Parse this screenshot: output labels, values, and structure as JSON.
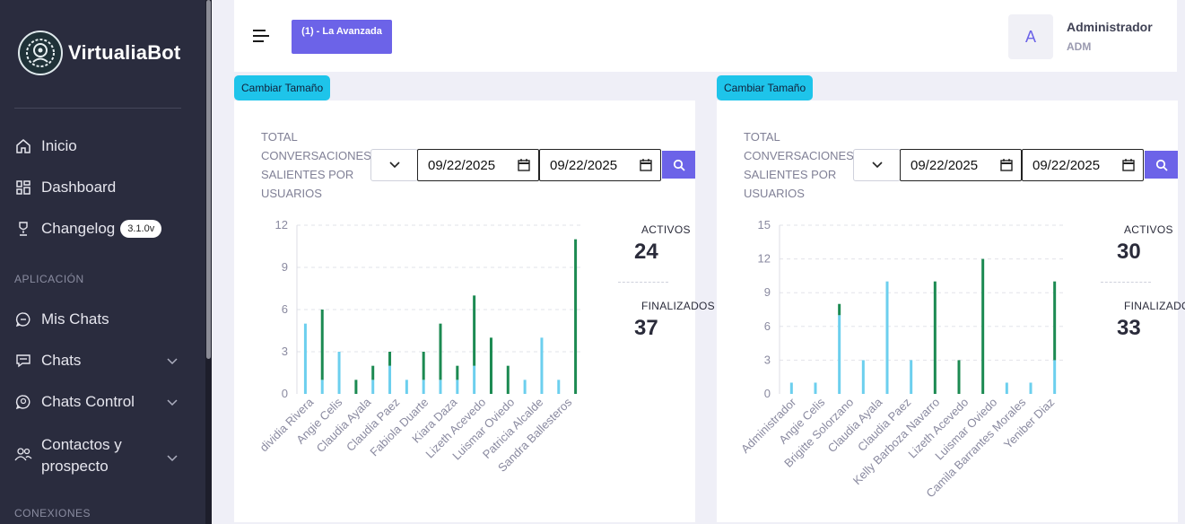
{
  "brand": {
    "name": "VirtualiaBot"
  },
  "sidebar": {
    "items": [
      {
        "label": "Inicio",
        "icon": "home-icon"
      },
      {
        "label": "Dashboard",
        "icon": "grid-icon"
      },
      {
        "label": "Changelog",
        "icon": "trophy-icon",
        "badge": "3.1.0v"
      },
      {
        "label": "Mis Chats",
        "icon": "chat-icon"
      },
      {
        "label": "Chats",
        "icon": "chat-square-icon"
      },
      {
        "label": "Chats Control",
        "icon": "chat-search-icon"
      },
      {
        "label": "Contactos y prospecto",
        "icon": "users-icon"
      }
    ],
    "sections": [
      "APLICACIÓN",
      "CONEXIONES"
    ]
  },
  "header": {
    "company_button": "(1) - La Avanzada",
    "avatar_letter": "A",
    "user_name": "Administrador",
    "user_role": "ADM"
  },
  "colors": {
    "accent": "#6c63e8",
    "cyan": "#1ec4ea",
    "bar_light": "#6ccfee",
    "bar_dark": "#1c8a52",
    "sidebar": "#2a2c3e"
  },
  "cards": [
    {
      "resize_label": "Cambiar Tamaño",
      "title": "TOTAL CONVERSACIONES SALIENTES POR USUARIOS",
      "date_from": "09/22/2025",
      "date_to": "09/22/2025",
      "activos_label": "ACTIVOS",
      "activos": "24",
      "finalizados_label": "FINALIZADOS",
      "finalizados": "37"
    },
    {
      "resize_label": "Cambiar Tamaño",
      "title": "TOTAL CONVERSACIONES SALIENTES POR USUARIOS",
      "date_from": "09/22/2025",
      "date_to": "09/22/2025",
      "activos_label": "ACTIVOS",
      "activos": "30",
      "finalizados_label": "FINALIZADOS",
      "finalizados": "33"
    }
  ],
  "chart_data": [
    {
      "type": "bar",
      "stacked": true,
      "ylim": [
        0,
        12
      ],
      "yticks": [
        0,
        3,
        6,
        9,
        12
      ],
      "xlabels": [
        "dividia Rivera",
        "Angie Celis",
        "Claudia Ayala",
        "Claudia Paez",
        "Fabiola Duarte",
        "Kiara Daza",
        "Lizeth Acevedo",
        "Luismar Oviedo",
        "Patricia Alcalde",
        "Sandra Ballesteros"
      ],
      "series": [
        {
          "color": "#6ccfee",
          "values": [
            5,
            1,
            3,
            0,
            1,
            2,
            1,
            1,
            1,
            1,
            2,
            0,
            0,
            1,
            4,
            1,
            0
          ]
        },
        {
          "color": "#1c8a52",
          "values": [
            0,
            5,
            0,
            1,
            1,
            1,
            0,
            2,
            4,
            1,
            5,
            4,
            2,
            0,
            0,
            0,
            11
          ]
        }
      ]
    },
    {
      "type": "bar",
      "stacked": true,
      "ylim": [
        0,
        15
      ],
      "yticks": [
        0,
        3,
        6,
        9,
        12,
        15
      ],
      "xlabels": [
        "Administrador",
        "Angie Celis",
        "Brigitte Solorzano",
        "Claudia Ayala",
        "Claudia Paez",
        "Kelly Barboza Navarro",
        "Lizeth Acevedo",
        "Luismar Oviedo",
        "Camila Barrantes Morales",
        "Yeniber Diaz"
      ],
      "series": [
        {
          "color": "#6ccfee",
          "values": [
            1,
            1,
            7,
            3,
            10,
            3,
            0,
            0,
            0,
            1,
            1,
            3
          ]
        },
        {
          "color": "#1c8a52",
          "values": [
            0,
            0,
            1,
            0,
            0,
            0,
            10,
            3,
            12,
            0,
            0,
            7
          ]
        }
      ]
    }
  ]
}
